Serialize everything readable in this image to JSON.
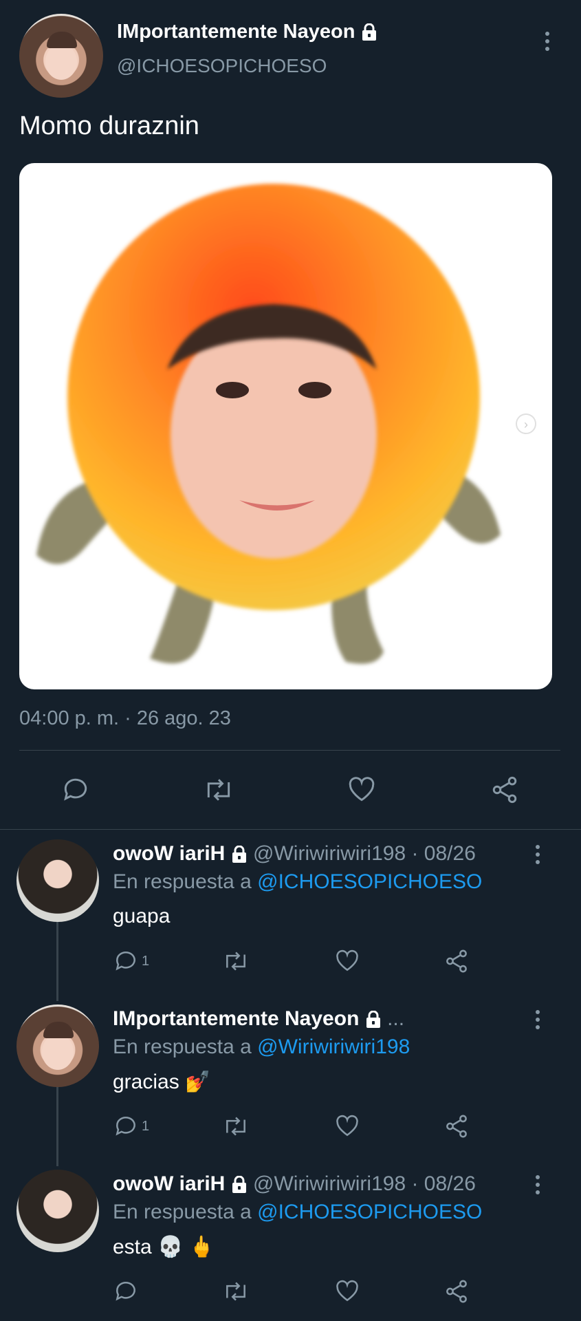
{
  "main_tweet": {
    "author_name": "IMportantemente Nayeon",
    "handle": "@ICHOESOPICHOESO",
    "text": "Momo duraznin",
    "timestamp": "04:00 p. m. · 26 ago. 23"
  },
  "replies": [
    {
      "author_name": "owoW iariH",
      "handle_meta": "@Wiriwiriwiri198 · 08/26",
      "reply_label": "En respuesta a",
      "reply_to": "@ICHOESOPICHOESO",
      "text": "guapa",
      "emoji": "",
      "reply_count": "1"
    },
    {
      "author_name": "IMportantemente Nayeon",
      "handle_meta": "...",
      "reply_label": "En respuesta a",
      "reply_to": "@Wiriwiriwiri198",
      "text": "gracias",
      "emoji": "💅",
      "reply_count": "1"
    },
    {
      "author_name": "owoW iariH",
      "handle_meta": "@Wiriwiriwiri198 · 08/26",
      "reply_label": "En respuesta a",
      "reply_to": "@ICHOESOPICHOESO",
      "text": "esta",
      "emoji": "💀 🖕",
      "reply_count": ""
    }
  ],
  "icons": [
    "lock-icon",
    "more-icon",
    "reply-icon",
    "retweet-icon",
    "like-icon",
    "share-icon",
    "image-next-icon"
  ],
  "colors": {
    "background": "#15202b",
    "muted": "#8899a6",
    "link": "#1d9bf0",
    "divider": "#38444d"
  }
}
